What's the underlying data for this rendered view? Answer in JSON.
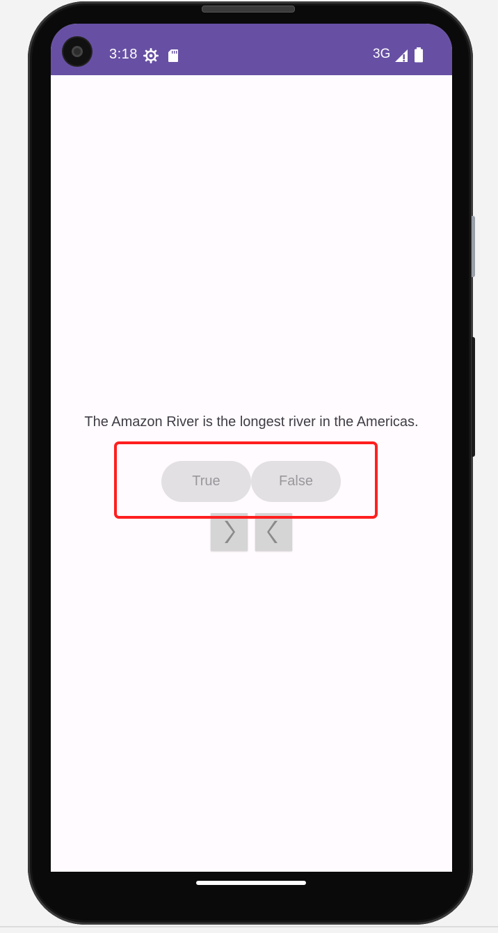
{
  "status_bar": {
    "time": "3:18",
    "network": "3G",
    "icons": [
      "settings-icon",
      "sd-card-icon",
      "signal-icon",
      "battery-icon"
    ],
    "background_color": "#6750a4"
  },
  "main": {
    "question": "The Amazon River is the longest river in the Americas.",
    "true_label": "True",
    "false_label": "False",
    "next_icon": "chevron-right-icon",
    "prev_icon": "chevron-left-icon"
  },
  "colors": {
    "screen_background": "#fffbfe",
    "answer_button_background": "#e3e0e4",
    "nav_button_background": "#d5d5d5",
    "highlight": "#ff1f1f"
  }
}
